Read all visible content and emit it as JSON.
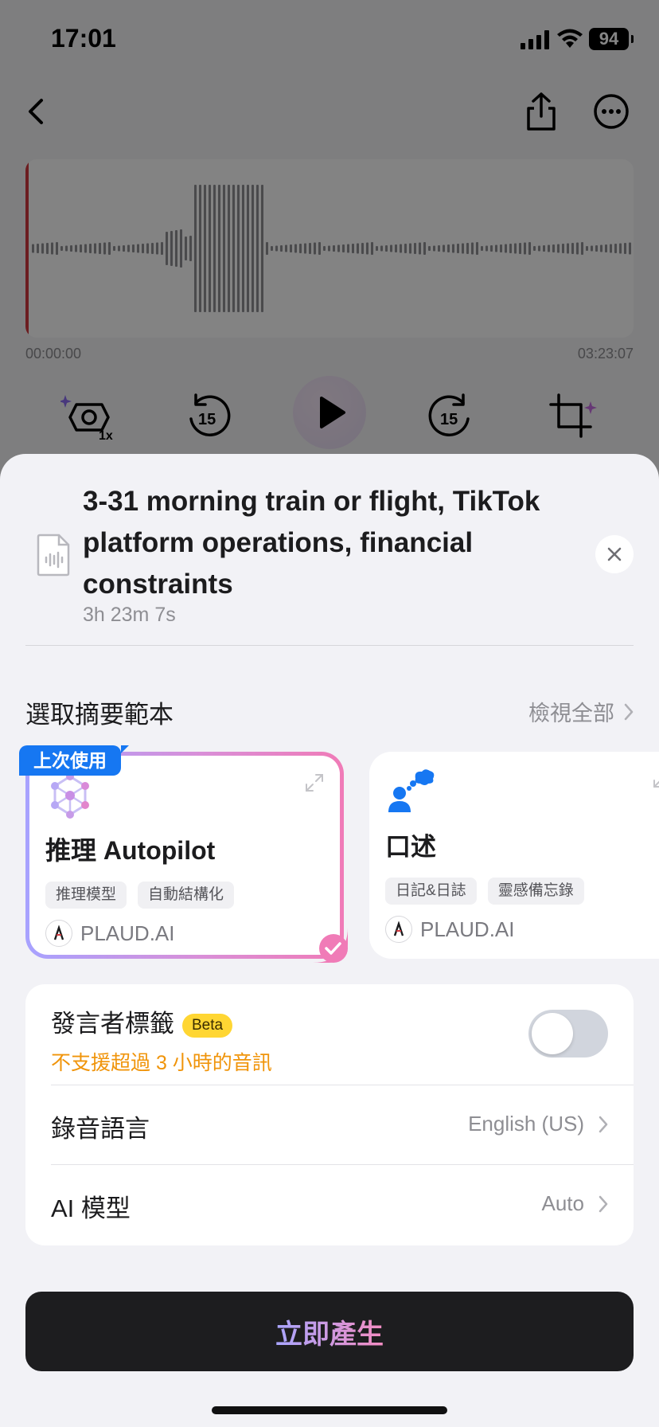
{
  "status_bar": {
    "time": "17:01",
    "battery": "94"
  },
  "player": {
    "time_start": "00:00:00",
    "time_end": "03:23:07",
    "speed_label": "1x",
    "skip_seconds": "15"
  },
  "sheet": {
    "recording_title": "3-31 morning train or flight, TikTok platform operations, financial constraints",
    "duration": "3h 23m 7s",
    "section_title": "選取摘要範本",
    "view_all": "檢視全部",
    "templates": [
      {
        "badge": "上次使用",
        "name": "推理 Autopilot",
        "tags": [
          "推理模型",
          "自動結構化"
        ],
        "author": "PLAUD.AI",
        "selected": true,
        "icon": "network-nodes-icon"
      },
      {
        "name": "口述",
        "tags": [
          "日記&日誌",
          "靈感備忘錄"
        ],
        "author": "PLAUD.AI",
        "selected": false,
        "icon": "speaking-person-icon"
      }
    ],
    "settings": {
      "speaker_label": "發言者標籤",
      "beta": "Beta",
      "speaker_warning": "不支援超過 3 小時的音訊",
      "speaker_enabled": false,
      "language_label": "錄音語言",
      "language_value": "English (US)",
      "model_label": "AI 模型",
      "model_value": "Auto"
    },
    "generate_label": "立即產生"
  },
  "colors": {
    "accent_blue": "#1677f2",
    "warning": "#f0940a",
    "gradient_start": "#a7a2ff",
    "gradient_end": "#f07bb7"
  }
}
